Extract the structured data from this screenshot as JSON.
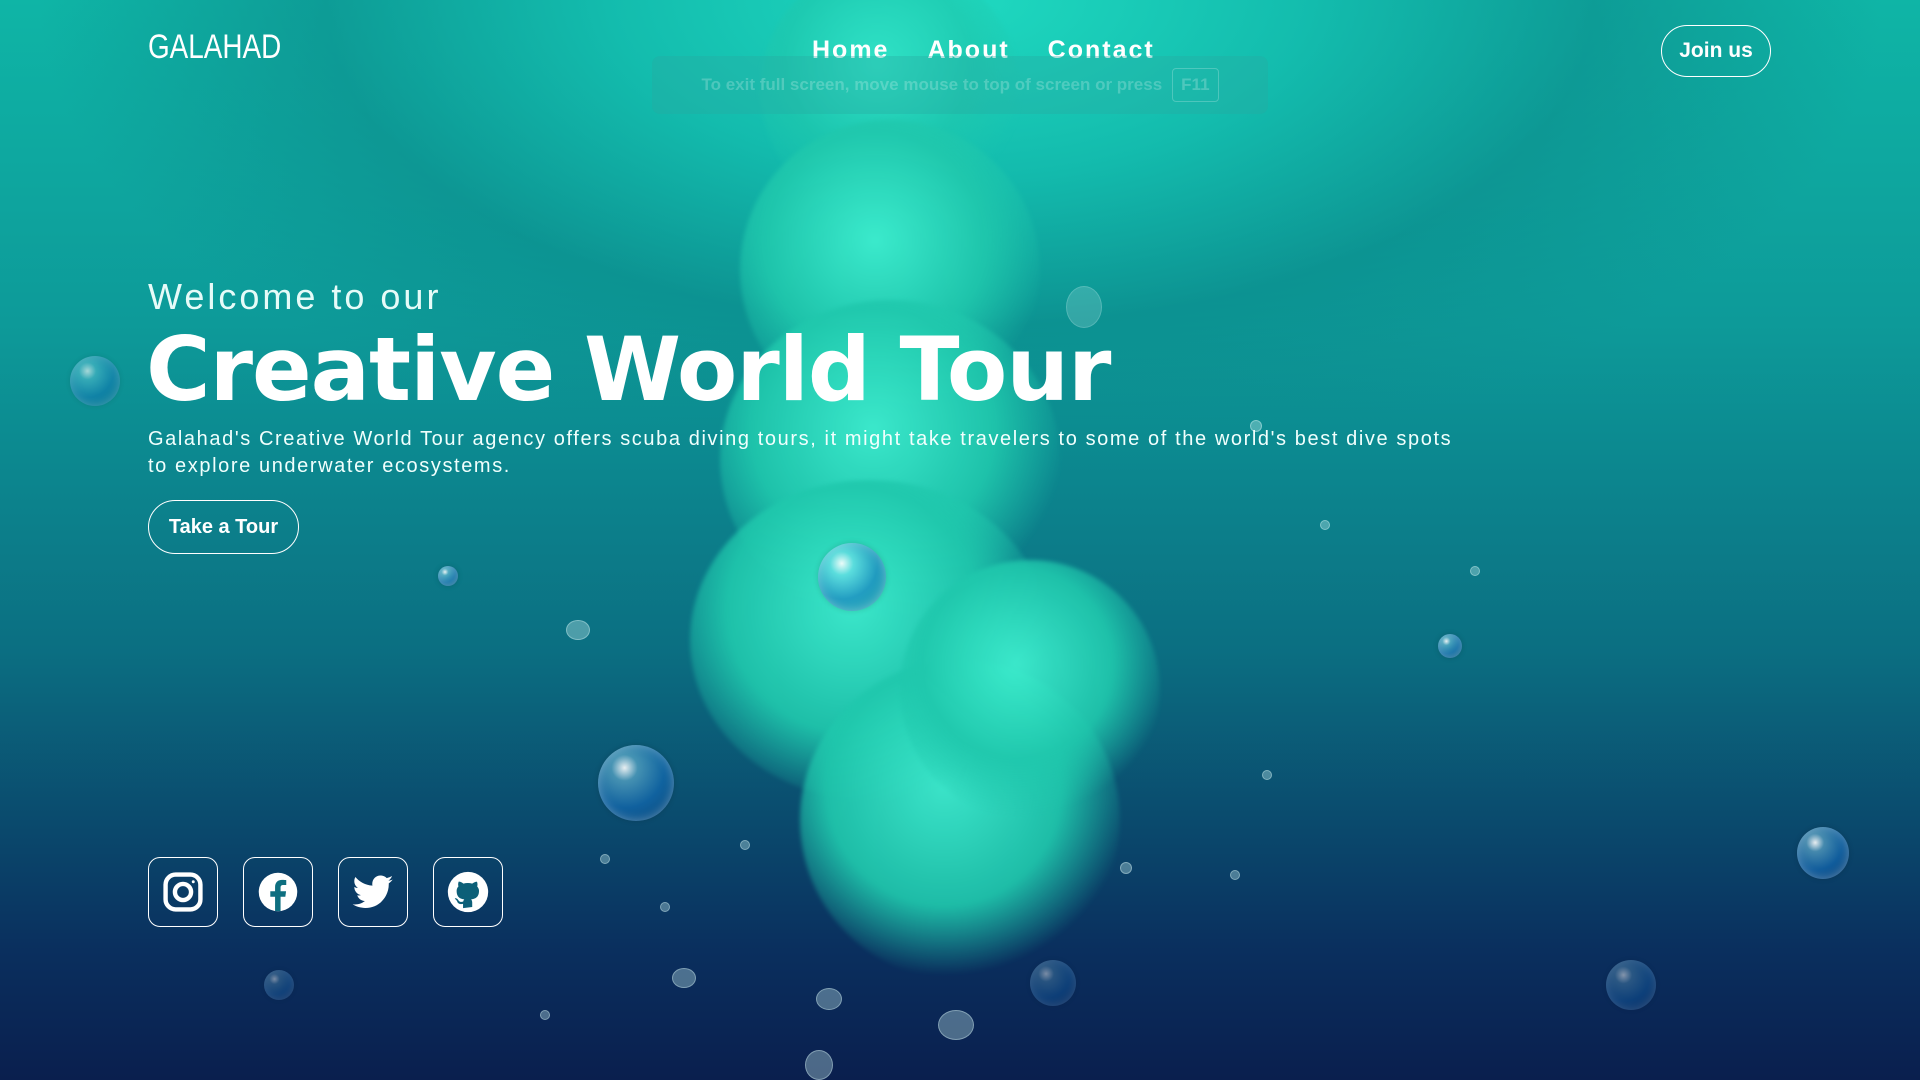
{
  "header": {
    "logo": "GALAHAD",
    "nav": [
      "Home",
      "About",
      "Contact"
    ],
    "join_label": "Join us"
  },
  "fullscreen_notice": {
    "text": "To exit full screen, move mouse to top of screen or press",
    "key": "F11"
  },
  "hero": {
    "welcome": "Welcome to our",
    "title": "Creative World Tour",
    "description": "Galahad's Creative World Tour agency offers scuba diving tours, it might take travelers to some of the world's best dive spots to explore underwater ecosystems.",
    "cta_label": "Take a Tour"
  },
  "social": {
    "icons": [
      "instagram-icon",
      "facebook-icon",
      "twitter-icon",
      "github-icon"
    ]
  },
  "colors": {
    "accent": "#1fd9c0",
    "deep": "#0a1f4e",
    "text": "#ffffff"
  }
}
